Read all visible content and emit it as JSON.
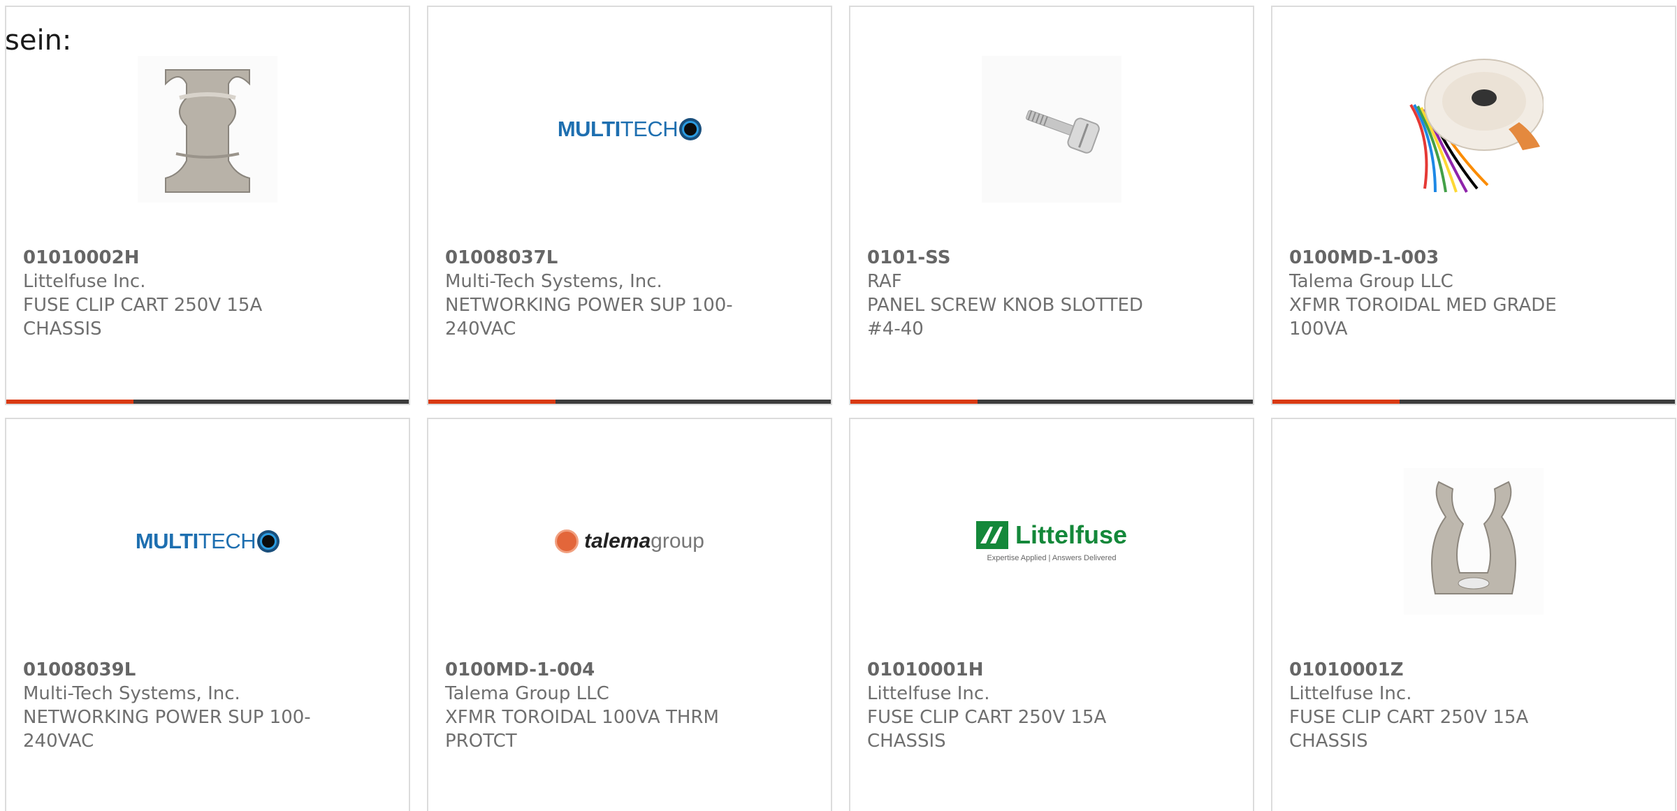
{
  "intro_text": "sein:",
  "products": [
    {
      "part_number": "01010002H",
      "manufacturer": "Littelfuse Inc.",
      "description": "FUSE CLIP CART 250V 15A CHASSIS",
      "image": "fuse-clip-photo"
    },
    {
      "part_number": "01008037L",
      "manufacturer": "Multi-Tech Systems, Inc.",
      "description": "NETWORKING POWER SUP 100-240VAC",
      "image": "multitech-logo",
      "logo_text_bold": "MULTI",
      "logo_text": "TECH"
    },
    {
      "part_number": "0101-SS",
      "manufacturer": "RAF",
      "description": "PANEL SCREW KNOB SLOTTED #4-40",
      "image": "panel-screw-photo"
    },
    {
      "part_number": "0100MD-1-003",
      "manufacturer": "Talema Group LLC",
      "description": "XFMR TOROIDAL MED GRADE 100VA",
      "image": "toroidal-transformer-photo"
    },
    {
      "part_number": "01008039L",
      "manufacturer": "Multi-Tech Systems, Inc.",
      "description": "NETWORKING POWER SUP 100-240VAC",
      "image": "multitech-logo",
      "logo_text_bold": "MULTI",
      "logo_text": "TECH"
    },
    {
      "part_number": "0100MD-1-004",
      "manufacturer": "Talema Group LLC",
      "description": "XFMR TOROIDAL 100VA THRM PROTCT",
      "image": "talema-logo",
      "logo_text_bold": "talema",
      "logo_text": "group"
    },
    {
      "part_number": "01010001H",
      "manufacturer": "Littelfuse Inc.",
      "description": "FUSE CLIP CART 250V 15A CHASSIS",
      "image": "littelfuse-logo",
      "logo_text": "Littelfuse",
      "logo_tagline": "Expertise Applied | Answers Delivered"
    },
    {
      "part_number": "01010001Z",
      "manufacturer": "Littelfuse Inc.",
      "description": "FUSE CLIP CART 250V 15A CHASSIS",
      "image": "fuse-clip-open-photo"
    }
  ],
  "colors": {
    "accent": "#d93a12",
    "bar": "#3d3d3d",
    "border": "#dcdcdc",
    "text": "#6f6f6f"
  }
}
